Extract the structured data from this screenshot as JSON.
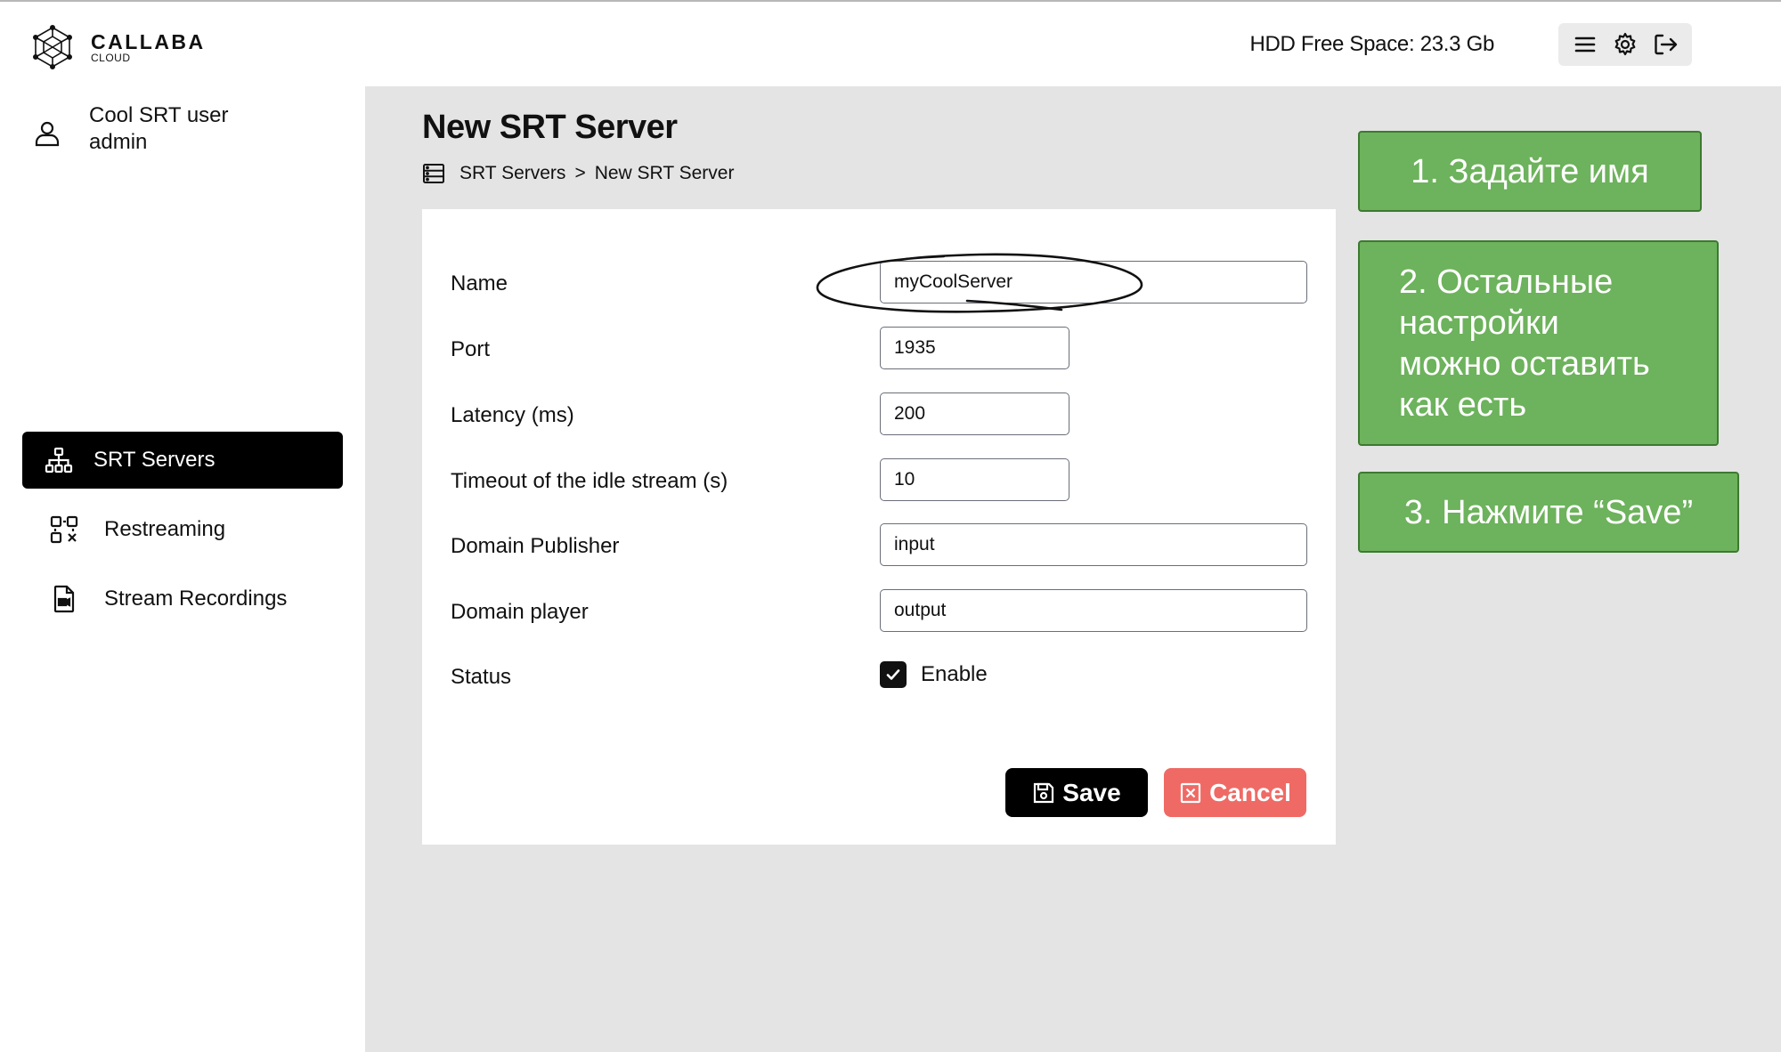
{
  "app": {
    "logo_name": "CALLABA",
    "logo_sub": "CLOUD"
  },
  "user": {
    "name": "Cool SRT user",
    "role": "admin",
    "icon": "user-icon"
  },
  "sidebar": {
    "items": [
      {
        "label": "SRT Servers",
        "icon": "sitemap-icon",
        "active": true
      },
      {
        "label": "Restreaming",
        "icon": "restream-icon",
        "active": false
      },
      {
        "label": "Stream Recordings",
        "icon": "file-video-icon",
        "active": false
      }
    ]
  },
  "topbar": {
    "hdd": "HDD Free Space: 23.3 Gb",
    "tools": [
      "menu-icon",
      "gear-icon",
      "logout-icon"
    ]
  },
  "page": {
    "title": "New SRT Server",
    "breadcrumb": [
      "SRT Servers",
      ">",
      "New SRT Server"
    ]
  },
  "form": {
    "name": {
      "label": "Name",
      "value": "myCoolServer"
    },
    "port": {
      "label": "Port",
      "value": "1935"
    },
    "latency": {
      "label": "Latency (ms)",
      "value": "200"
    },
    "timeout": {
      "label": "Timeout of the idle stream (s)",
      "value": "10"
    },
    "domain_publisher": {
      "label": "Domain Publisher",
      "value": "input"
    },
    "domain_player": {
      "label": "Domain player",
      "value": "output"
    },
    "status": {
      "label": "Status",
      "option": "Enable",
      "checked": true
    },
    "save_label": "Save",
    "cancel_label": "Cancel"
  },
  "callouts": {
    "step1": "1. Задайте имя",
    "step2_lines": [
      "2. Остальные",
      "настройки",
      "можно оставить",
      "как есть"
    ],
    "step3": "3. Нажмите “Save”"
  },
  "colors": {
    "callout_bg": "#6db25c",
    "cancel_bg": "#ef6a65",
    "active_nav": "#000000"
  }
}
